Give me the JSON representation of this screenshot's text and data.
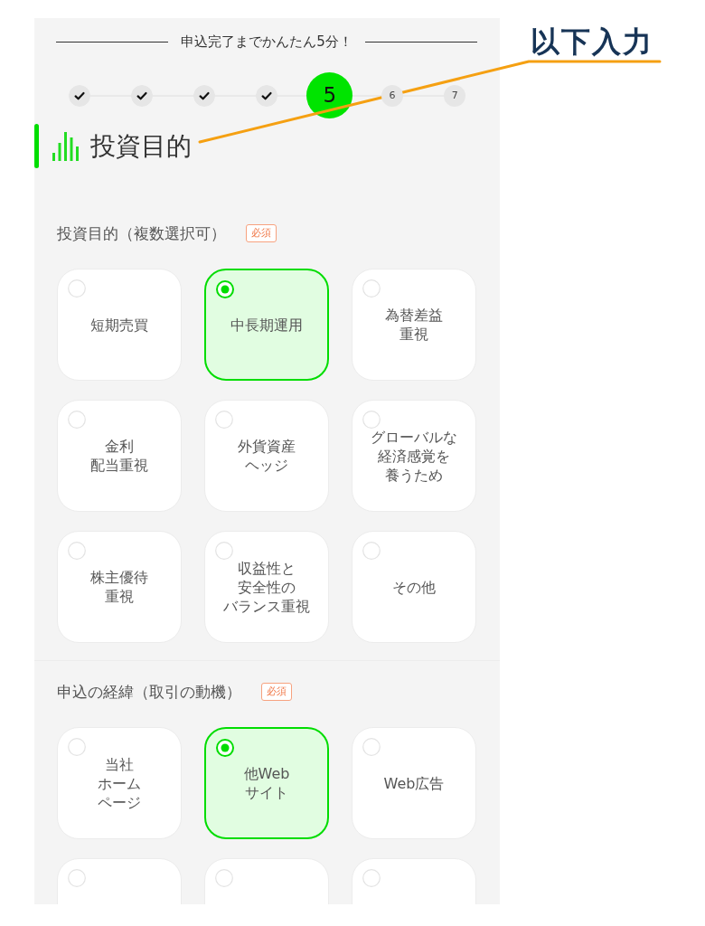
{
  "annotation": {
    "text": "以下入力"
  },
  "progress": {
    "caption": "申込完了までかんたん5分！",
    "steps": [
      {
        "completed": true,
        "current": false
      },
      {
        "completed": true,
        "current": false
      },
      {
        "completed": true,
        "current": false
      },
      {
        "completed": true,
        "current": false
      },
      {
        "label": "5",
        "completed": false,
        "current": true
      },
      {
        "label": "6",
        "completed": false,
        "current": false
      },
      {
        "label": "7",
        "completed": false,
        "current": false
      }
    ]
  },
  "page_title": "投資目的",
  "questions": [
    {
      "label": "投資目的（複数選択可）",
      "badge": "必須",
      "options": [
        {
          "lines": [
            "短期売買"
          ],
          "selected": false
        },
        {
          "lines": [
            "中長期運用"
          ],
          "selected": true
        },
        {
          "lines": [
            "為替差益",
            "重視"
          ],
          "selected": false
        },
        {
          "lines": [
            "金利",
            "配当重視"
          ],
          "selected": false
        },
        {
          "lines": [
            "外貨資産",
            "ヘッジ"
          ],
          "selected": false
        },
        {
          "lines": [
            "グローバルな",
            "経済感覚を",
            "養うため"
          ],
          "selected": false
        },
        {
          "lines": [
            "株主優待",
            "重視"
          ],
          "selected": false
        },
        {
          "lines": [
            "収益性と",
            "安全性の",
            "バランス重視"
          ],
          "selected": false
        },
        {
          "lines": [
            "その他"
          ],
          "selected": false
        }
      ]
    },
    {
      "label": "申込の経緯（取引の動機）",
      "badge": "必須",
      "options": [
        {
          "lines": [
            "当社",
            "ホーム",
            "ページ"
          ],
          "selected": false
        },
        {
          "lines": [
            "他Web",
            "サイト"
          ],
          "selected": true
        },
        {
          "lines": [
            "Web広告"
          ],
          "selected": false
        },
        {
          "selected": false
        },
        {
          "selected": false
        },
        {
          "selected": false
        }
      ]
    }
  ]
}
